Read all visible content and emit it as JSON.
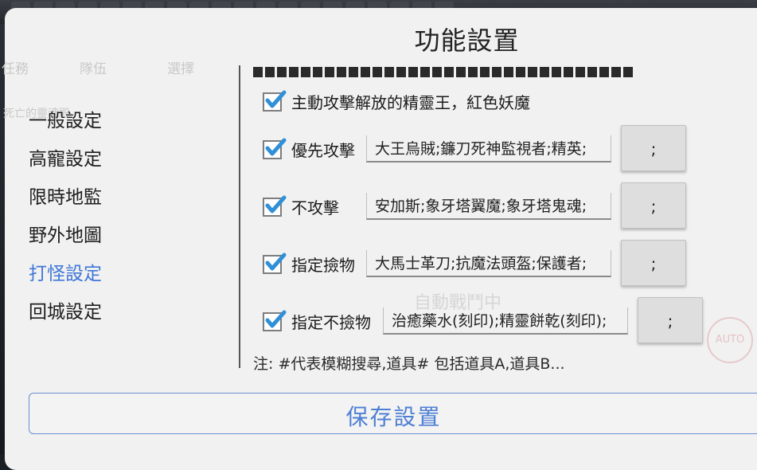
{
  "dialog": {
    "title": "功能設置",
    "watermark": {
      "tab_left": "任務",
      "tab_team": "隊伍",
      "tab_select": "選擇",
      "line": "死亡的靈魂殿"
    },
    "sidebar": {
      "items": [
        {
          "label": "一般設定",
          "active": false
        },
        {
          "label": "高寵設定",
          "active": false
        },
        {
          "label": "限時地監",
          "active": false
        },
        {
          "label": "野外地圖",
          "active": false
        },
        {
          "label": "打怪設定",
          "active": true
        },
        {
          "label": "回城設定",
          "active": false
        }
      ]
    },
    "options": {
      "auto_attack": {
        "checked": true,
        "label": "主動攻擊解放的精靈王，紅色妖魔"
      },
      "priority_attack": {
        "checked": true,
        "label": "優先攻擊",
        "value": "大王烏賊;鐮刀死神監視者;精英;",
        "button": ";"
      },
      "no_attack": {
        "checked": true,
        "label": "不攻擊",
        "value": "安加斯;象牙塔翼魔;象牙塔鬼魂;",
        "button": ";"
      },
      "pickup": {
        "checked": true,
        "label": "指定撿物",
        "value": "大馬士革刀;抗魔法頭盔;保護者;",
        "button": ";"
      },
      "no_pickup": {
        "checked": true,
        "label": "指定不撿物",
        "value": "治癒藥水(刻印);精靈餅乾(刻印);",
        "button": ";"
      }
    },
    "note": "注: #代表模糊搜尋,道具# 包括道具A,道具B...",
    "save_label": "保存設置",
    "background_hint": "自動戰鬥中",
    "auto_badge": "AUTO"
  },
  "colors": {
    "accent": "#3f77d8",
    "save_text": "#4d7fd4",
    "checkbox": "#2f8fd8"
  }
}
